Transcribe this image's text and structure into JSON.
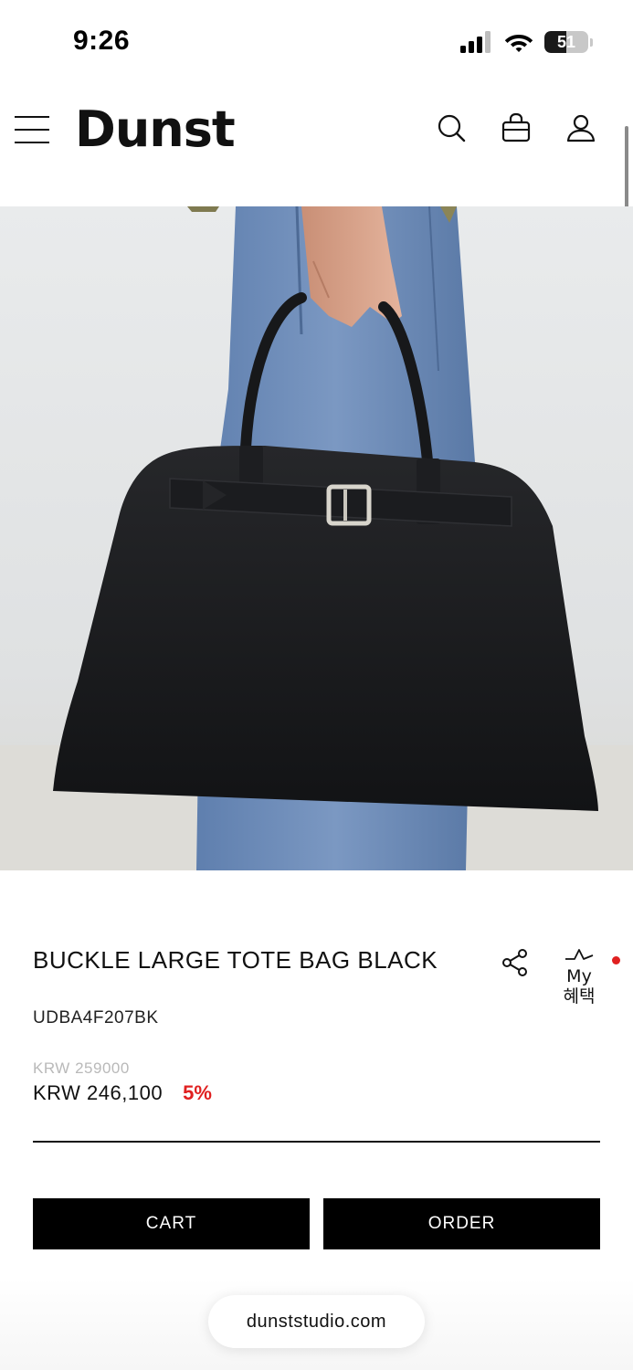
{
  "status_bar": {
    "time": "9:26",
    "battery_percent": 51,
    "battery_label": "51"
  },
  "header": {
    "logo": "Dunst",
    "icons": [
      "menu-icon",
      "search-icon",
      "bag-icon",
      "user-icon"
    ]
  },
  "hero": {
    "image": "product-photo-black-leather-tote-bag"
  },
  "product": {
    "title": "BUCKLE LARGE TOTE BAG BLACK",
    "sku": "UDBA4F207BK",
    "original_price": "KRW 259000",
    "sale_price": "KRW 246,100",
    "discount": "5%",
    "benefit_label_line1": "My",
    "benefit_label_line2": "혜택"
  },
  "actions": {
    "cart_label": "CART",
    "order_label": "ORDER"
  },
  "browser": {
    "url": "dunststudio.com"
  },
  "colors": {
    "accent_red": "#e02020",
    "button_black": "#000000",
    "muted_gray": "#b9b9b9"
  }
}
